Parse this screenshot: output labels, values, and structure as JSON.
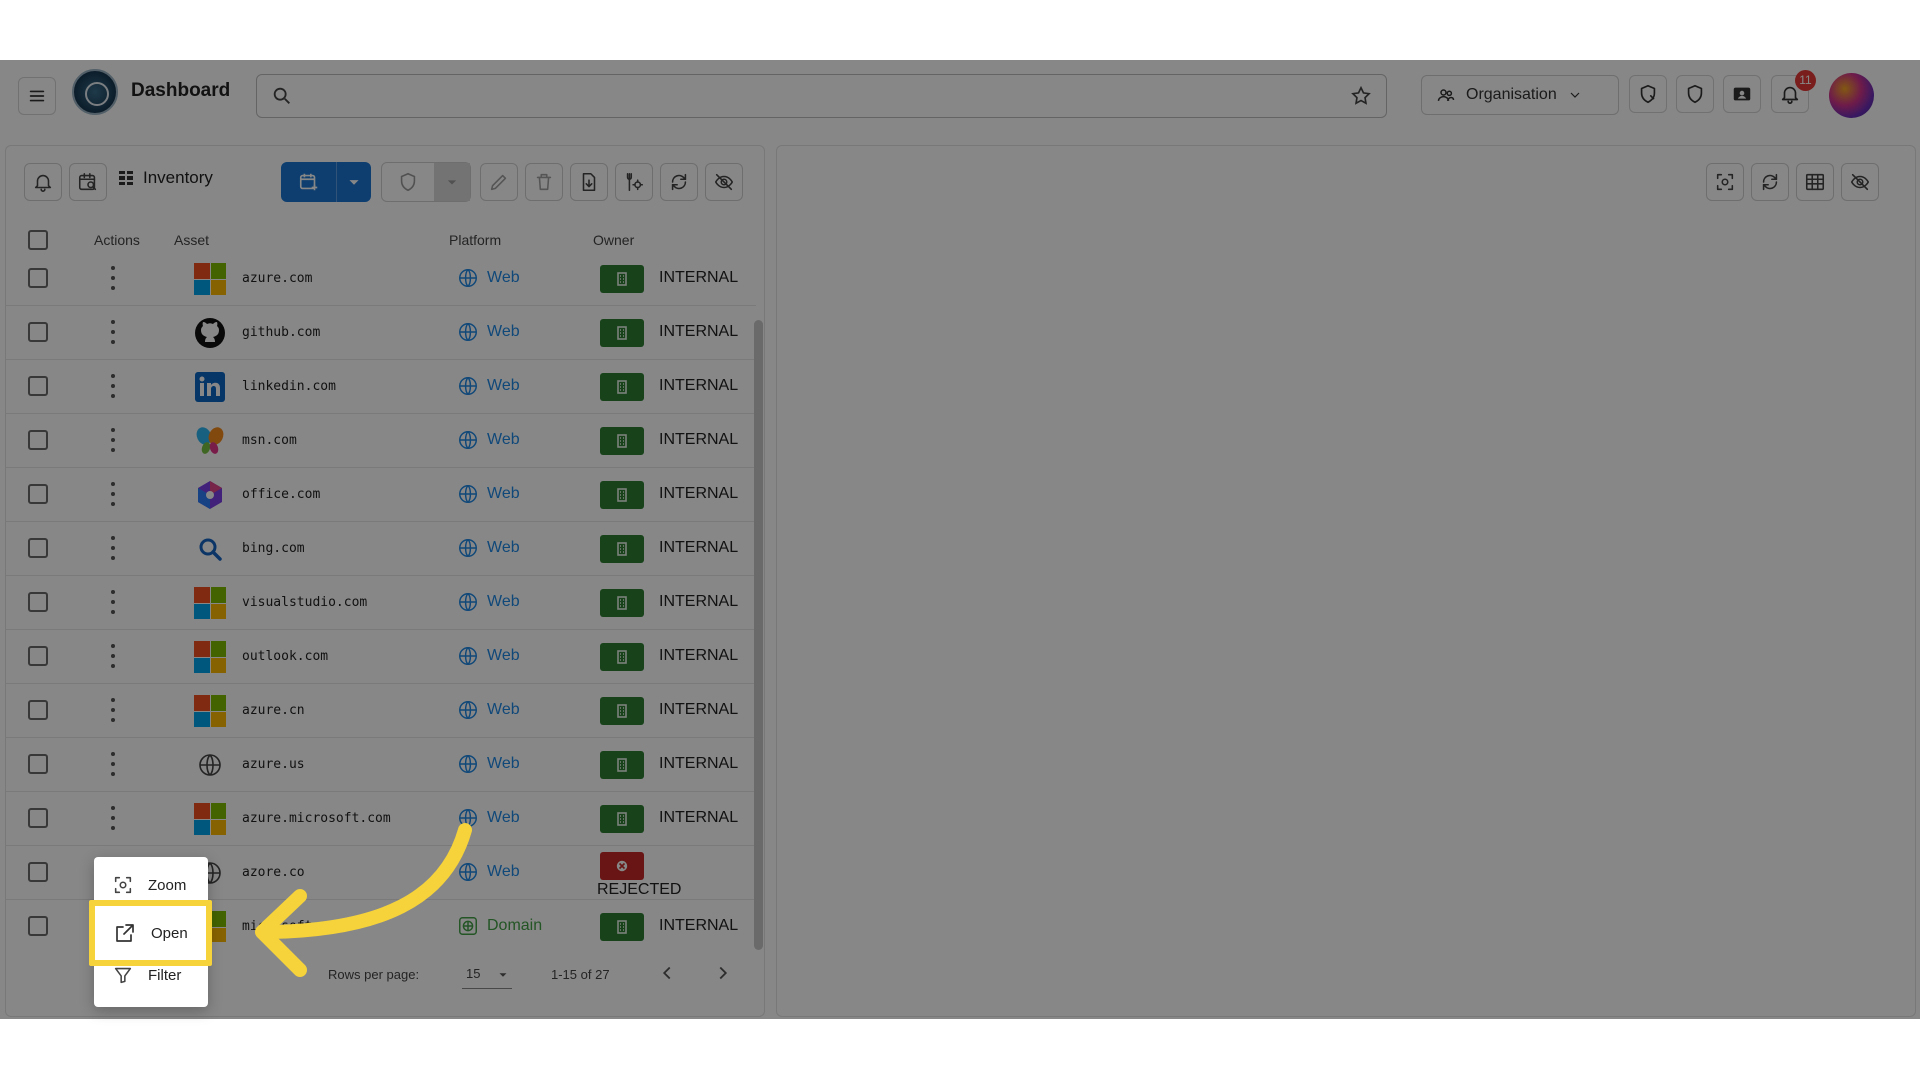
{
  "header": {
    "title": "Dashboard",
    "search_placeholder": "",
    "org_label": "Organisation",
    "notification_count": "11"
  },
  "inventory": {
    "title": "Inventory",
    "columns": {
      "actions": "Actions",
      "asset": "Asset",
      "platform": "Platform",
      "owner": "Owner"
    },
    "rows": [
      {
        "asset": "azure.com",
        "icon": "microsoft-icon",
        "platform": "Web",
        "owner": "INTERNAL"
      },
      {
        "asset": "github.com",
        "icon": "github-icon",
        "platform": "Web",
        "owner": "INTERNAL"
      },
      {
        "asset": "linkedin.com",
        "icon": "linkedin-icon",
        "platform": "Web",
        "owner": "INTERNAL"
      },
      {
        "asset": "msn.com",
        "icon": "msn-butterfly-icon",
        "platform": "Web",
        "owner": "INTERNAL"
      },
      {
        "asset": "office.com",
        "icon": "office-icon",
        "platform": "Web",
        "owner": "INTERNAL"
      },
      {
        "asset": "bing.com",
        "icon": "search-icon",
        "platform": "Web",
        "owner": "INTERNAL"
      },
      {
        "asset": "visualstudio.com",
        "icon": "microsoft-icon",
        "platform": "Web",
        "owner": "INTERNAL"
      },
      {
        "asset": "outlook.com",
        "icon": "microsoft-icon",
        "platform": "Web",
        "owner": "INTERNAL"
      },
      {
        "asset": "azure.cn",
        "icon": "microsoft-icon",
        "platform": "Web",
        "owner": "INTERNAL"
      },
      {
        "asset": "azure.us",
        "icon": "globe-icon",
        "platform": "Web",
        "owner": "INTERNAL"
      },
      {
        "asset": "azure.microsoft.com",
        "icon": "microsoft-icon",
        "platform": "Web",
        "owner": "INTERNAL"
      },
      {
        "asset": "azore.co",
        "icon": "globe-icon",
        "platform": "Web",
        "owner": "REJECTED"
      },
      {
        "asset": "microsoft.com",
        "icon": "microsoft-icon",
        "platform": "Domain",
        "owner": "INTERNAL"
      }
    ],
    "footer": {
      "rows_per_page_label": "Rows per page:",
      "rows_per_page": "15",
      "range": "1-15 of 27"
    }
  },
  "context_menu": {
    "items": [
      {
        "label": "Zoom",
        "icon": "zoom-focus-icon"
      },
      {
        "label": "Open",
        "icon": "open-external-icon"
      },
      {
        "label": "Filter",
        "icon": "filter-icon"
      }
    ]
  },
  "colors": {
    "primary": "#1976d2",
    "internal": "#2e7d32",
    "rejected": "#c62828",
    "highlight": "#f6d33a",
    "web_link": "#1e88e5",
    "domain_link": "#43a047"
  }
}
